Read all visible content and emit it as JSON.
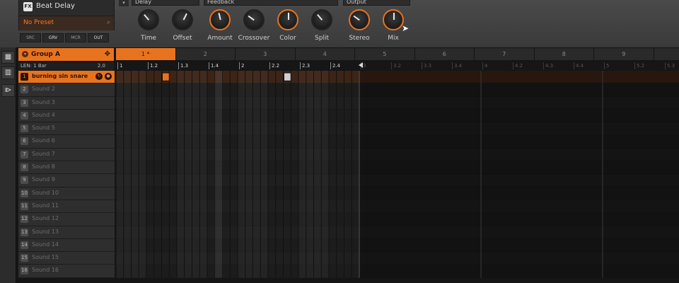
{
  "plugin": {
    "fx_badge": "FX",
    "name": "Beat Delay",
    "preset": "No Preset",
    "buttons": [
      "SRC",
      "GRV",
      "MCR",
      "OUT"
    ]
  },
  "sections": {
    "delay": "Delay",
    "feedback": "Feedback",
    "output": "Output"
  },
  "knobs": [
    {
      "label": "Time",
      "orange": false,
      "value": 0.35
    },
    {
      "label": "Offset",
      "orange": false,
      "value": 0.6
    },
    {
      "label": "Amount",
      "orange": true,
      "value": 0.45
    },
    {
      "label": "Crossover",
      "orange": false,
      "value": 0.3
    },
    {
      "label": "Color",
      "orange": true,
      "value": 0.5
    },
    {
      "label": "Split",
      "orange": false,
      "value": 0.35
    },
    {
      "label": "Stereo",
      "orange": true,
      "value": 0.3
    },
    {
      "label": "Mix",
      "orange": true,
      "value": 0.5
    }
  ],
  "group": {
    "name": "Group A",
    "length_label": "LEN: 1 Bar",
    "length_value": "2.0"
  },
  "patterns": [
    "1 *",
    "2",
    "3",
    "4",
    "5",
    "6",
    "7",
    "8",
    "9"
  ],
  "ruler": {
    "bright": [
      "1",
      "1.2",
      "1.3",
      "1.4",
      "2",
      "2.2",
      "2.3",
      "2.4"
    ],
    "dim": [
      "3",
      "3.2",
      "3.3",
      "3.4",
      "4",
      "4.2",
      "4.3",
      "4.4",
      "5",
      "5.2",
      "5.3"
    ]
  },
  "sounds": [
    {
      "num": "1",
      "name": "burning sin snare",
      "selected": true
    },
    {
      "num": "2",
      "name": "Sound 2"
    },
    {
      "num": "3",
      "name": "Sound 3"
    },
    {
      "num": "4",
      "name": "Sound 4"
    },
    {
      "num": "5",
      "name": "Sound 5"
    },
    {
      "num": "6",
      "name": "Sound 6"
    },
    {
      "num": "7",
      "name": "Sound 7"
    },
    {
      "num": "8",
      "name": "Sound 8"
    },
    {
      "num": "9",
      "name": "Sound 9"
    },
    {
      "num": "10",
      "name": "Sound 10"
    },
    {
      "num": "11",
      "name": "Sound 11"
    },
    {
      "num": "12",
      "name": "Sound 12"
    },
    {
      "num": "13",
      "name": "Sound 13"
    },
    {
      "num": "14",
      "name": "Sound 14"
    },
    {
      "num": "15",
      "name": "Sound 15"
    },
    {
      "num": "16",
      "name": "Sound 16"
    }
  ],
  "notes": [
    {
      "sound": 1,
      "step": 6,
      "color": "#e8731e"
    },
    {
      "sound": 1,
      "step": 22,
      "color": "#cfcfcf"
    }
  ],
  "colors": {
    "accent": "#e8731e"
  }
}
